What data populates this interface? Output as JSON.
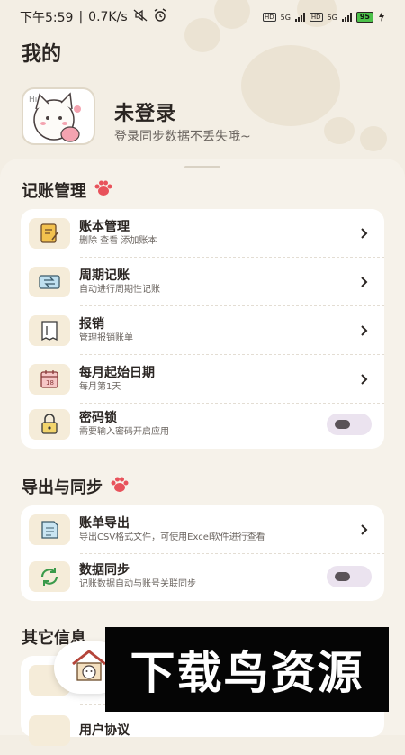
{
  "status_bar": {
    "time": "下午5:59",
    "speed": "0.7K/s",
    "network1": "5G",
    "network2": "5G",
    "battery": "95"
  },
  "header": {
    "title": "我的"
  },
  "profile": {
    "name": "未登录",
    "subtitle": "登录同步数据不丢失哦~"
  },
  "sections": [
    {
      "title": "记账管理",
      "items": [
        {
          "title": "账本管理",
          "subtitle": "删除 查看 添加账本",
          "icon": "ledger-icon",
          "control": "chevron"
        },
        {
          "title": "周期记账",
          "subtitle": "自动进行周期性记账",
          "icon": "cycle-icon",
          "control": "chevron"
        },
        {
          "title": "报销",
          "subtitle": "管理报销账单",
          "icon": "reimburse-icon",
          "control": "chevron"
        },
        {
          "title": "每月起始日期",
          "subtitle": "每月第1天",
          "icon": "calendar-icon",
          "control": "chevron"
        },
        {
          "title": "密码锁",
          "subtitle": "需要输入密码开启应用",
          "icon": "lock-icon",
          "control": "toggle"
        }
      ]
    },
    {
      "title": "导出与同步",
      "items": [
        {
          "title": "账单导出",
          "subtitle": "导出CSV格式文件，可使用Excel软件进行查看",
          "icon": "export-icon",
          "control": "chevron"
        },
        {
          "title": "数据同步",
          "subtitle": "记账数据自动与账号关联同步",
          "icon": "sync-icon",
          "control": "toggle"
        }
      ]
    },
    {
      "title": "其它信息",
      "items": [
        {
          "title": "用户协议",
          "subtitle": "",
          "icon": "agreement-icon",
          "control": "chevron"
        }
      ]
    }
  ],
  "overlay_ad": {
    "text": "下载鸟资源"
  },
  "colors": {
    "background": "#f3eee4",
    "card": "#ffffff",
    "icon_bg": "#f5ecd9",
    "paw": "#e8525b"
  }
}
